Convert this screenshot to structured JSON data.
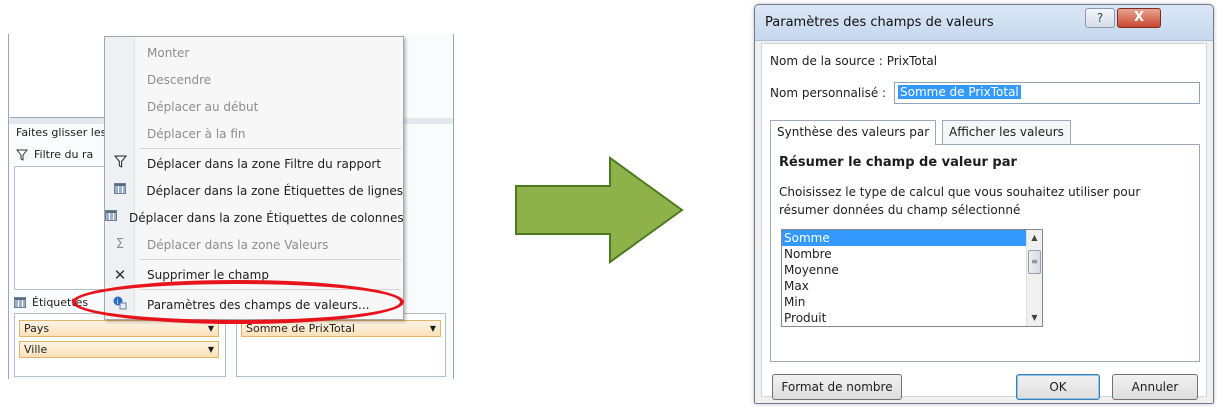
{
  "colors": {
    "highlight_ellipse": "#e8141b",
    "arrow_fill": "#8fb14a",
    "arrow_border": "#4d7a21",
    "selection": "#3399ff"
  },
  "field_pane": {
    "drag_hint": "Faites glisser les",
    "filter_label": "Filtre du ra",
    "rows_label": "Étiquettes",
    "rows_fields": [
      "Pays",
      "Ville"
    ],
    "values_field": "Somme de PrixTotal"
  },
  "context_menu": {
    "items": [
      {
        "label": "Monter",
        "enabled": false,
        "icon": ""
      },
      {
        "label": "Descendre",
        "enabled": false,
        "icon": ""
      },
      {
        "label": "Déplacer au début",
        "enabled": false,
        "icon": ""
      },
      {
        "label": "Déplacer à la fin",
        "enabled": false,
        "icon": ""
      },
      {
        "label": "Déplacer dans la zone Filtre du rapport",
        "enabled": true,
        "icon": "filter-icon"
      },
      {
        "label": "Déplacer dans la zone Étiquettes de lignes",
        "enabled": true,
        "icon": "row-labels-icon"
      },
      {
        "label": "Déplacer dans la zone Étiquettes de colonnes",
        "enabled": true,
        "icon": "column-labels-icon"
      },
      {
        "label": "Déplacer dans la zone Valeurs",
        "enabled": false,
        "icon": "sigma-icon"
      },
      {
        "label": "Supprimer le champ",
        "enabled": true,
        "icon": "remove-x-icon"
      },
      {
        "label": "Paramètres des champs de valeurs...",
        "enabled": true,
        "icon": "field-settings-icon"
      }
    ]
  },
  "dialog": {
    "title": "Paramètres des champs de valeurs",
    "help_label": "?",
    "close_label": "X",
    "source_label": "Nom de la source :",
    "source_value": "PrixTotal",
    "custom_name_label": "Nom personnalisé :",
    "custom_name_value": "Somme de PrixTotal",
    "tabs": [
      {
        "label": "Synthèse des valeurs par",
        "active": true
      },
      {
        "label": "Afficher les valeurs",
        "active": false
      }
    ],
    "section_heading": "Résumer le champ de valeur par",
    "description": "Choisissez le type de calcul que vous souhaitez utiliser pour résumer données du champ sélectionné",
    "functions": [
      "Somme",
      "Nombre",
      "Moyenne",
      "Max",
      "Min",
      "Produit"
    ],
    "selected_function": "Somme",
    "number_format_button": "Format de nombre",
    "ok_button": "OK",
    "cancel_button": "Annuler"
  }
}
